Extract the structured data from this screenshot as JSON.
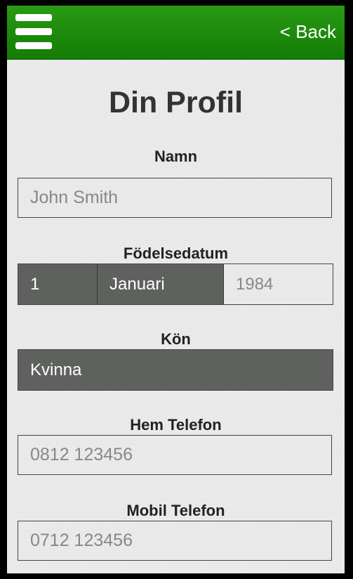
{
  "topbar": {
    "menu_icon": "hamburger-menu-icon",
    "back_label": "< Back",
    "color": "#1a8a0a"
  },
  "page": {
    "title": "Din Profil"
  },
  "form": {
    "name": {
      "label": "Namn",
      "placeholder": "John Smith"
    },
    "birthdate": {
      "label": "Födelsedatum",
      "day": "1",
      "month": "Januari",
      "year_placeholder": "1984"
    },
    "gender": {
      "label": "Kön",
      "value": "Kvinna"
    },
    "home_phone": {
      "label": "Hem Telefon",
      "placeholder": "0812 123456"
    },
    "mobile_phone": {
      "label": "Mobil Telefon",
      "placeholder": "0712 123456"
    }
  }
}
